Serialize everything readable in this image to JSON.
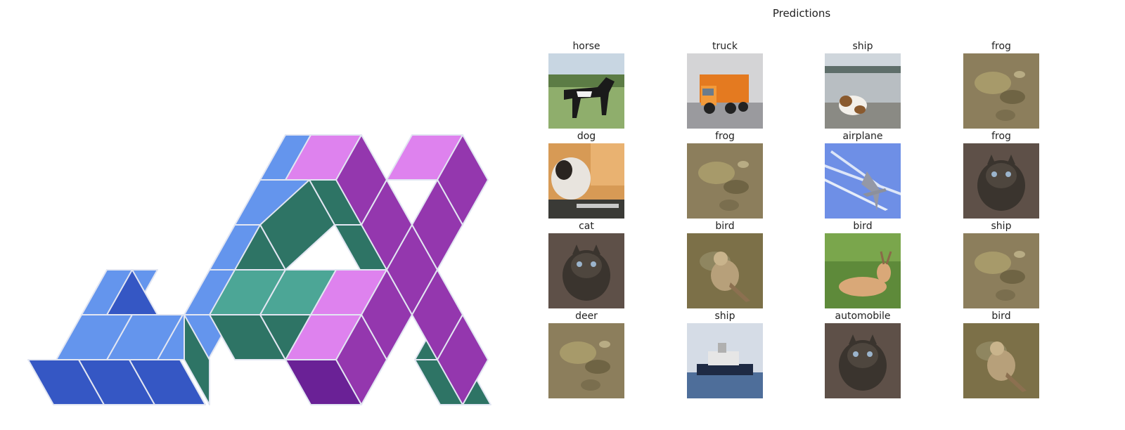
{
  "title": "Predictions",
  "logo": {
    "name": "JAX",
    "colors": {
      "blue_top": "#6495ED",
      "blue_front": "#3557C4",
      "green_top": "#4CA696",
      "green_front": "#2E7465",
      "pink_top": "#DE82EE",
      "purple_front": "#9437AE",
      "purple_dark": "#6A2196",
      "edge": "#E2E6F2"
    }
  },
  "predictions": [
    {
      "label": "horse",
      "image": "horse-photo"
    },
    {
      "label": "truck",
      "image": "truck-photo"
    },
    {
      "label": "ship",
      "image": "dog-on-beach-photo"
    },
    {
      "label": "frog",
      "image": "frog-photo"
    },
    {
      "label": "dog",
      "image": "dog-photo"
    },
    {
      "label": "frog",
      "image": "frog-photo"
    },
    {
      "label": "airplane",
      "image": "airplane-photo"
    },
    {
      "label": "frog",
      "image": "cat-photo"
    },
    {
      "label": "cat",
      "image": "cat-photo"
    },
    {
      "label": "bird",
      "image": "bird-photo"
    },
    {
      "label": "bird",
      "image": "deer-photo"
    },
    {
      "label": "ship",
      "image": "frog-photo"
    },
    {
      "label": "deer",
      "image": "frog-photo"
    },
    {
      "label": "ship",
      "image": "ship-photo"
    },
    {
      "label": "automobile",
      "image": "cat-photo"
    },
    {
      "label": "bird",
      "image": "bird-photo"
    }
  ]
}
